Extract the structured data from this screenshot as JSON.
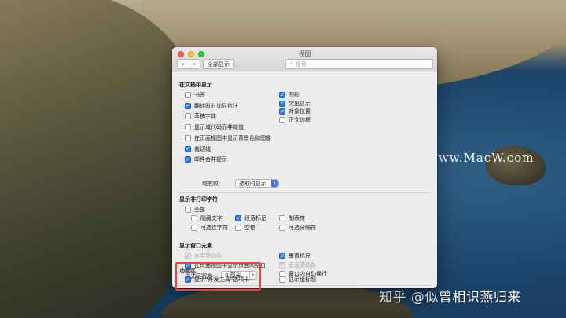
{
  "window": {
    "title": "视图",
    "show_all_label": "全部显示",
    "search_placeholder": "搜索",
    "back_glyph": "‹",
    "forward_glyph": "›"
  },
  "sections": {
    "document": {
      "title": "在文档中显示",
      "left": [
        {
          "label": "书签",
          "checked": false
        },
        {
          "label": "翻转时时加显批注",
          "checked": true
        },
        {
          "label": "草稿字体",
          "checked": false
        },
        {
          "label": "显示域代码而非域值",
          "checked": false
        },
        {
          "label": "在页面视图中显示背景色和图像",
          "checked": false
        },
        {
          "label": "裁切线",
          "checked": true
        },
        {
          "label": "邮件合并提示",
          "checked": true
        }
      ],
      "right": [
        {
          "label": "图形",
          "checked": true
        },
        {
          "label": "突出显示",
          "checked": true
        },
        {
          "label": "对象位置",
          "checked": true
        },
        {
          "label": "正文边框",
          "checked": false
        }
      ],
      "field_shading_label": "域底纹:",
      "field_shading_value": "选取时显示"
    },
    "nonprinting": {
      "title": "显示非打印字符",
      "all_label": "全部",
      "all_checked": false,
      "items": [
        {
          "label": "隐藏文字",
          "checked": false
        },
        {
          "label": "段落标记",
          "checked": true
        },
        {
          "label": "制表符",
          "checked": false
        },
        {
          "label": "可选连字符",
          "checked": false
        },
        {
          "label": "空格",
          "checked": false
        },
        {
          "label": "可选分隔符",
          "checked": false
        }
      ]
    },
    "window_elements": {
      "title": "显示窗口元素",
      "left": [
        {
          "label": "水平滚动条",
          "checked": true,
          "disabled": true
        },
        {
          "label": "在页面视图中显示页面间空白",
          "checked": true,
          "disabled": false
        }
      ],
      "right": [
        {
          "label": "垂直标尺",
          "checked": true,
          "disabled": false
        },
        {
          "label": "垂直滚动条",
          "checked": true,
          "disabled": true
        },
        {
          "label": "窗口内自动换行",
          "checked": false,
          "disabled": false
        }
      ],
      "style_area_label": "样式区宽度:",
      "style_area_value": "0 厘米"
    },
    "ribbon": {
      "title": "功能区",
      "developer_tab": {
        "label": "显示“开发工具”选项卡",
        "checked": true
      },
      "group_titles": {
        "label": "显示组标题",
        "checked": false
      }
    }
  },
  "overlay": {
    "watermark": "www.MacW.com",
    "credit": "知乎 @似曾相识燕归来",
    "highlight_color": "#e8453c"
  },
  "colors": {
    "accent": "#2c79f0"
  }
}
